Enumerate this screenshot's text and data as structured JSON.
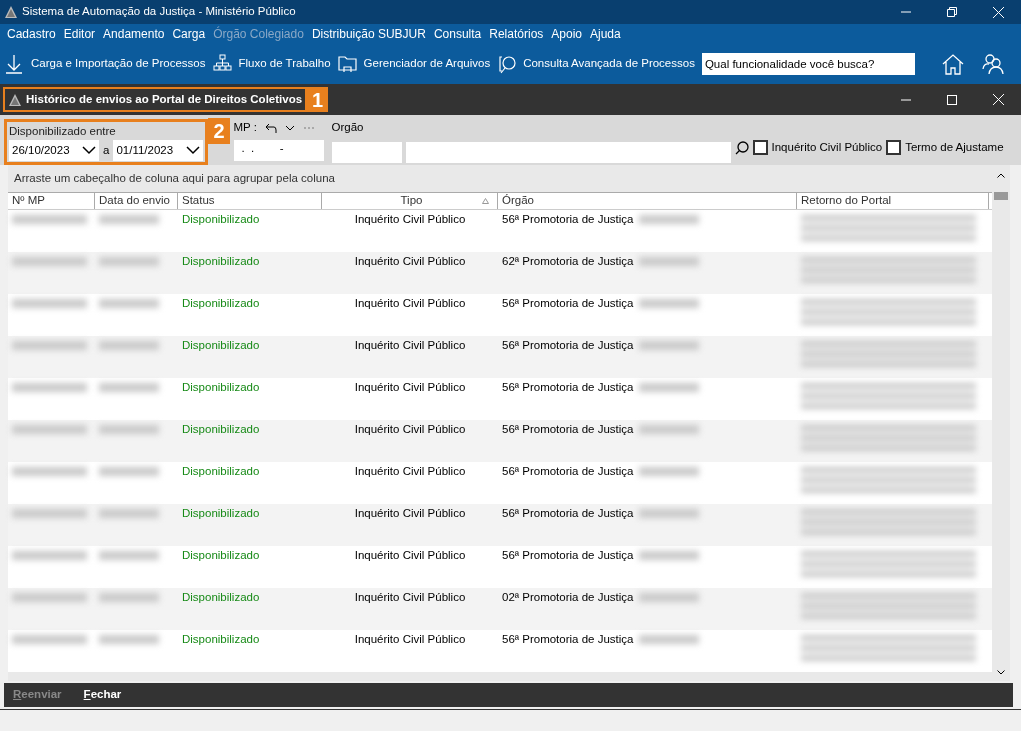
{
  "window": {
    "title": "Sistema de Automação da Justiça - Ministério Público"
  },
  "menu": [
    {
      "label": "Cadastro",
      "disabled": false
    },
    {
      "label": "Editor",
      "disabled": false
    },
    {
      "label": "Andamento",
      "disabled": false
    },
    {
      "label": "Carga",
      "disabled": false
    },
    {
      "label": "Órgão Colegiado",
      "disabled": true
    },
    {
      "label": "Distribuição SUBJUR",
      "disabled": false
    },
    {
      "label": "Consulta",
      "disabled": false
    },
    {
      "label": "Relatórios",
      "disabled": false
    },
    {
      "label": "Apoio",
      "disabled": false
    },
    {
      "label": "Ajuda",
      "disabled": false
    }
  ],
  "toolbar": [
    {
      "label": "Carga e Importação de Processos",
      "kind": "download"
    },
    {
      "label": "Fluxo de Trabalho",
      "kind": "hierarchy"
    },
    {
      "label": "Gerenciador de Arquivos",
      "kind": "folder"
    },
    {
      "label": "Consulta Avançada de Processos",
      "kind": "search"
    }
  ],
  "search": {
    "placeholder": "Qual funcionalidade você busca?"
  },
  "dialog": {
    "title": "Histórico  de envios ao Portal de Direitos Coletivos",
    "callout": "1"
  },
  "filters": {
    "date_label": "Disponibilizado entre",
    "date_from": "26/10/2023",
    "separator": "a",
    "date_to": "01/11/2023",
    "callout": "2",
    "mp_label": "MP :",
    "mp_value": ".  .        -",
    "orgao_label": "Orgão",
    "checkboxes": [
      {
        "label": "Inquérito Civil Público",
        "checked": false
      },
      {
        "label": "Termo de Ajustame",
        "checked": false
      }
    ]
  },
  "grid": {
    "group_hint": "Arraste um cabeçalho de coluna aqui para agrupar pela coluna",
    "columns": [
      "Nº MP",
      "Data do envio",
      "Status",
      "Tipo",
      "Órgão",
      "Retorno do Portal"
    ],
    "rows": [
      {
        "status": "Disponibilizado",
        "tipo": "Inquérito Civil Público",
        "orgao": "56ª Promotoria de Justiça"
      },
      {
        "status": "Disponibilizado",
        "tipo": "Inquérito Civil Público",
        "orgao": "62ª Promotoria de Justiça"
      },
      {
        "status": "Disponibilizado",
        "tipo": "Inquérito Civil Público",
        "orgao": "56ª Promotoria de Justiça"
      },
      {
        "status": "Disponibilizado",
        "tipo": "Inquérito Civil Público",
        "orgao": "56ª Promotoria de Justiça"
      },
      {
        "status": "Disponibilizado",
        "tipo": "Inquérito Civil Público",
        "orgao": "56ª Promotoria de Justiça"
      },
      {
        "status": "Disponibilizado",
        "tipo": "Inquérito Civil Público",
        "orgao": "56ª Promotoria de Justiça"
      },
      {
        "status": "Disponibilizado",
        "tipo": "Inquérito Civil Público",
        "orgao": "56ª Promotoria de Justiça"
      },
      {
        "status": "Disponibilizado",
        "tipo": "Inquérito Civil Público",
        "orgao": "56ª Promotoria de Justiça"
      },
      {
        "status": "Disponibilizado",
        "tipo": "Inquérito Civil Público",
        "orgao": "56ª Promotoria de Justiça"
      },
      {
        "status": "Disponibilizado",
        "tipo": "Inquérito Civil Público",
        "orgao": "02ª Promotoria de Justiça"
      },
      {
        "status": "Disponibilizado",
        "tipo": "Inquérito Civil Público",
        "orgao": "56ª Promotoria de Justiça"
      }
    ]
  },
  "buttons": [
    {
      "label": "Reenviar",
      "disabled": true
    },
    {
      "label": "Fechar",
      "disabled": false
    }
  ]
}
